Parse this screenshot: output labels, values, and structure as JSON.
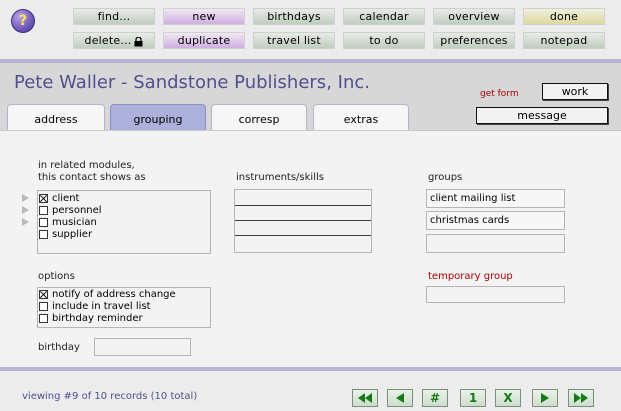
{
  "toolbar": {
    "help_label": "?",
    "row1": [
      {
        "label": "find...",
        "style": "g"
      },
      {
        "label": "new",
        "style": "p"
      },
      {
        "label": "birthdays",
        "style": "g"
      },
      {
        "label": "calendar",
        "style": "g"
      },
      {
        "label": "overview",
        "style": "g"
      },
      {
        "label": "done",
        "style": "y"
      }
    ],
    "row2": [
      {
        "label": "delete...",
        "style": "g"
      },
      {
        "label": "duplicate",
        "style": "p"
      },
      {
        "label": "travel list",
        "style": "g"
      },
      {
        "label": "to do",
        "style": "g"
      },
      {
        "label": "preferences",
        "style": "g"
      },
      {
        "label": "notepad",
        "style": "g"
      }
    ]
  },
  "header": {
    "title": "Pete Waller - Sandstone Publishers, Inc.",
    "get_form": "get form",
    "work_button": "work",
    "message_button": "message"
  },
  "tabs": [
    {
      "label": "address",
      "active": false
    },
    {
      "label": "grouping",
      "active": true
    },
    {
      "label": "corresp",
      "active": false
    },
    {
      "label": "extras",
      "active": false
    }
  ],
  "related": {
    "heading_line1": "in related modules,",
    "heading_line2": "this contact shows as",
    "items": [
      {
        "label": "client",
        "checked": true
      },
      {
        "label": "personnel",
        "checked": false
      },
      {
        "label": "musician",
        "checked": false
      },
      {
        "label": "supplier",
        "checked": false
      }
    ]
  },
  "instruments": {
    "heading": "instruments/skills"
  },
  "groups": {
    "heading": "groups",
    "values": [
      "client mailing list",
      "christmas cards",
      ""
    ],
    "temporary_label": "temporary group",
    "temporary_value": ""
  },
  "options": {
    "heading": "options",
    "items": [
      {
        "label": "notify of address change",
        "checked": true
      },
      {
        "label": "include in travel list",
        "checked": false
      },
      {
        "label": "birthday reminder",
        "checked": false
      }
    ]
  },
  "birthday": {
    "label": "birthday",
    "value": ""
  },
  "footer": {
    "status": "viewing #9 of 10 records (10 total)",
    "nav": [
      {
        "name": "first-record",
        "icon": "double-left"
      },
      {
        "name": "previous-record",
        "icon": "left"
      },
      {
        "name": "goto-record",
        "label": "#"
      },
      {
        "name": "record-one",
        "label": "1"
      },
      {
        "name": "delete-record",
        "label": "X"
      },
      {
        "name": "next-record",
        "icon": "right"
      },
      {
        "name": "last-record",
        "icon": "double-right"
      }
    ],
    "accent_color": "#137b13"
  }
}
